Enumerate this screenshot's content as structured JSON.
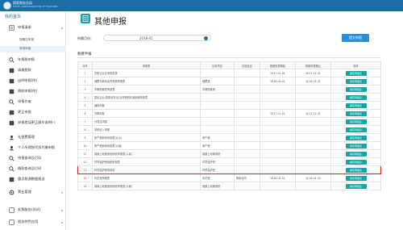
{
  "header": {
    "logo_title": "国家税务总局",
    "logo_subtitle": "STATE ADMINISTRATION OF TAXATION"
  },
  "sidebar": {
    "title": "我的首页",
    "items": [
      {
        "label": "申报清册",
        "icon": "list-icon"
      },
      {
        "label": "年报税申报",
        "icon": "search-icon"
      },
      {
        "label": "清缴税款",
        "icon": "tax-icon"
      },
      {
        "label": "出明申报(附)",
        "icon": "doc-icon"
      },
      {
        "label": "税收申报(附)",
        "icon": "doc-icon"
      },
      {
        "label": "申报作废",
        "icon": "search-icon"
      },
      {
        "label": "更正申报",
        "icon": "edit-icon"
      },
      {
        "label": "申报错误更正操作说明(-)",
        "icon": "doc-icon"
      },
      {
        "label": "社保费管理",
        "icon": "user-icon"
      },
      {
        "label": "个人所得税代扣代缴申报",
        "icon": "user-icon"
      },
      {
        "label": "申报查询及打印",
        "icon": "search-icon"
      },
      {
        "label": "缴款查询及打印",
        "icon": "search-icon"
      },
      {
        "label": "重点税源数据报送",
        "icon": "doc-icon"
      },
      {
        "label": "票业管理",
        "icon": "gear-icon"
      },
      {
        "label": "发票服务(测试)",
        "icon": "doc-icon"
      },
      {
        "label": "税务特色应用",
        "icon": "doc-icon"
      }
    ],
    "sub_items": [
      {
        "label": "按期应申报"
      },
      {
        "label": "其他申报"
      }
    ]
  },
  "main": {
    "title": "其他申报",
    "period_label": "所属月份:",
    "period_value": "2018-05",
    "query_button": "提交申报",
    "section_title": "税费申报"
  },
  "table": {
    "headers": [
      "序号",
      "申报表",
      "征收项目",
      "征收品目",
      "税款所属期起",
      "税款所属期止",
      "操作"
    ],
    "rows": [
      {
        "no": "1",
        "name": "关联企业往来报告表",
        "item": "",
        "subitem": "",
        "start": "2017-01-01",
        "end": "2017-12-31",
        "action": "填写申报表"
      },
      {
        "no": "2",
        "name": "储蓄存款利息所得税申报表",
        "item": "储蓄税",
        "subitem": "",
        "start": "2018-05-01",
        "end": "2018-05-31",
        "action": "填写申报表"
      },
      {
        "no": "3",
        "name": "车辆购置税申报表",
        "item": "车辆购置税",
        "subitem": "",
        "start": "",
        "end": "",
        "action": "填写申报表"
      },
      {
        "no": "4",
        "name": "居民企业(查账征收)企业所得税年度纳税申报表",
        "item": "",
        "subitem": "",
        "start": "",
        "end": "",
        "action": "填写申报表"
      },
      {
        "no": "5",
        "name": "通用申报",
        "item": "",
        "subitem": "",
        "start": "",
        "end": "",
        "action": "填写申报表"
      },
      {
        "no": "6",
        "name": "关联申报",
        "item": "",
        "subitem": "",
        "start": "2017-01-01",
        "end": "2017-12-31",
        "action": "填写申报表"
      },
      {
        "no": "7",
        "name": "分项目申报",
        "item": "",
        "subitem": "",
        "start": "",
        "end": "",
        "action": "填写申报表"
      },
      {
        "no": "8",
        "name": "非税收入申报",
        "item": "",
        "subitem": "",
        "start": "",
        "end": "",
        "action": "填写申报表"
      },
      {
        "no": "9",
        "name": "房产税纳税申报表(从价)",
        "item": "房产税",
        "subitem": "",
        "start": "",
        "end": "",
        "action": "填写申报表"
      },
      {
        "no": "10",
        "name": "房产税纳税申报表(从租)",
        "item": "房产税",
        "subitem": "",
        "start": "",
        "end": "",
        "action": "填写申报表"
      },
      {
        "no": "11",
        "name": "城镇土地使用税纳税申报表(从量)",
        "item": "城镇土地使用税",
        "subitem": "",
        "start": "",
        "end": "",
        "action": "填写申报表"
      },
      {
        "no": "12",
        "name": "环境保护税纳税申报表",
        "item": "环境保护税",
        "subitem": "",
        "start": "",
        "end": "",
        "action": "填写申报表"
      },
      {
        "no": "13",
        "name": "环境保护税申报表",
        "item": "环境保护税",
        "subitem": "",
        "start": "",
        "end": "",
        "action": "填写申报表"
      },
      {
        "no": "14",
        "name": "印花税申报表",
        "item": "印花税",
        "subitem": "购销合同",
        "start": "2018-04-01",
        "end": "2018-04-30",
        "action": "填写申报表"
      },
      {
        "no": "15",
        "name": "城镇土地使用税纳税申报表(从面)",
        "item": "城镇土地使用税",
        "subitem": "",
        "start": "",
        "end": "",
        "action": "填写申报表"
      }
    ]
  },
  "colors": {
    "brand": "#1b6ea6",
    "button": "#17a2a4",
    "highlight": "#e02020"
  }
}
